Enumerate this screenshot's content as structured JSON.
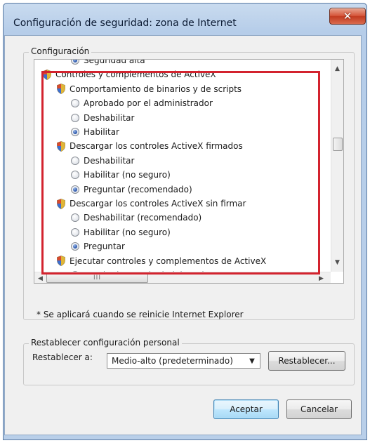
{
  "window": {
    "title": "Configuración de seguridad: zona de Internet",
    "close_symbol": "✕"
  },
  "settings_group": {
    "label": "Configuración"
  },
  "tree": {
    "rows": [
      {
        "kind": "radio",
        "label": "Seguridad alta",
        "checked": true,
        "level": 2
      },
      {
        "kind": "category",
        "label": "Controles y complementos de ActiveX",
        "level": 0
      },
      {
        "kind": "setting",
        "label": "Comportamiento de binarios y de scripts",
        "level": 1
      },
      {
        "kind": "radio",
        "label": "Aprobado por el administrador",
        "checked": false,
        "level": 2
      },
      {
        "kind": "radio",
        "label": "Deshabilitar",
        "checked": false,
        "level": 2
      },
      {
        "kind": "radio",
        "label": "Habilitar",
        "checked": true,
        "level": 2
      },
      {
        "kind": "setting",
        "label": "Descargar los controles ActiveX firmados",
        "level": 1
      },
      {
        "kind": "radio",
        "label": "Deshabilitar",
        "checked": false,
        "level": 2
      },
      {
        "kind": "radio",
        "label": "Habilitar (no seguro)",
        "checked": false,
        "level": 2
      },
      {
        "kind": "radio",
        "label": "Preguntar (recomendado)",
        "checked": true,
        "level": 2
      },
      {
        "kind": "setting",
        "label": "Descargar los controles ActiveX sin firmar",
        "level": 1
      },
      {
        "kind": "radio",
        "label": "Deshabilitar (recomendado)",
        "checked": false,
        "level": 2
      },
      {
        "kind": "radio",
        "label": "Habilitar (no seguro)",
        "checked": false,
        "level": 2
      },
      {
        "kind": "radio",
        "label": "Preguntar",
        "checked": true,
        "level": 2
      },
      {
        "kind": "setting",
        "label": "Ejecutar controles y complementos de ActiveX",
        "level": 1
      },
      {
        "kind": "radio",
        "label": "Aprobado por el administrador",
        "checked": true,
        "level": 2
      }
    ]
  },
  "scrollbar": {
    "up": "▲",
    "down": "▼",
    "left": "◀",
    "right": "▶",
    "grip": "III"
  },
  "note": "* Se aplicará cuando se reinicie Internet Explorer",
  "reset_group": {
    "label": "Restablecer configuración personal",
    "reset_to_label": "Restablecer a:",
    "selected_level": "Medio-alto (predeterminado)",
    "dropdown_arrow": "▼",
    "reset_button": "Restablecer..."
  },
  "footer": {
    "ok_button": "Aceptar",
    "cancel_button": "Cancelar"
  },
  "colors": {
    "highlight_box": "#d3232e",
    "close_button": "#c94a30",
    "title_bar": "#c0d5ee"
  }
}
